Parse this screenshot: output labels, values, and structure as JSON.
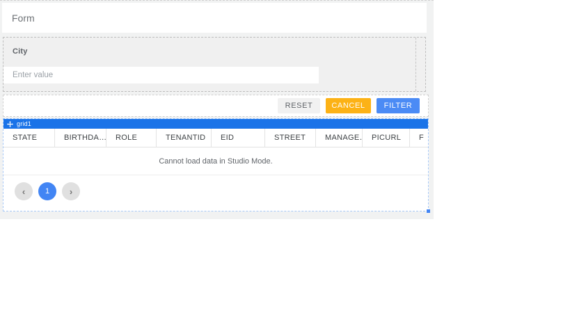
{
  "page": {
    "form_title": "Form"
  },
  "filter_form": {
    "field_label": "City",
    "placeholder": "Enter value",
    "value": ""
  },
  "actions": {
    "reset": "RESET",
    "cancel": "CANCEL",
    "filter": "FILTER"
  },
  "grid": {
    "widget_id": "grid1",
    "columns": [
      "STATE",
      "BIRTHDA…",
      "ROLE",
      "TENANTID",
      "EID",
      "STREET",
      "MANAGE…",
      "PICURL",
      "F"
    ],
    "empty_message": "Cannot load data in Studio Mode.",
    "pagination": {
      "prev_icon": "‹",
      "page": "1",
      "next_icon": "›"
    }
  },
  "colors": {
    "grid_titlebar_blue": "#1a73e8",
    "filter_button_blue": "#4b8bf5",
    "cancel_button_orange": "#fcb216",
    "page_active_blue": "#4285f4",
    "selection_dashed_blue": "#a6c8f7"
  }
}
